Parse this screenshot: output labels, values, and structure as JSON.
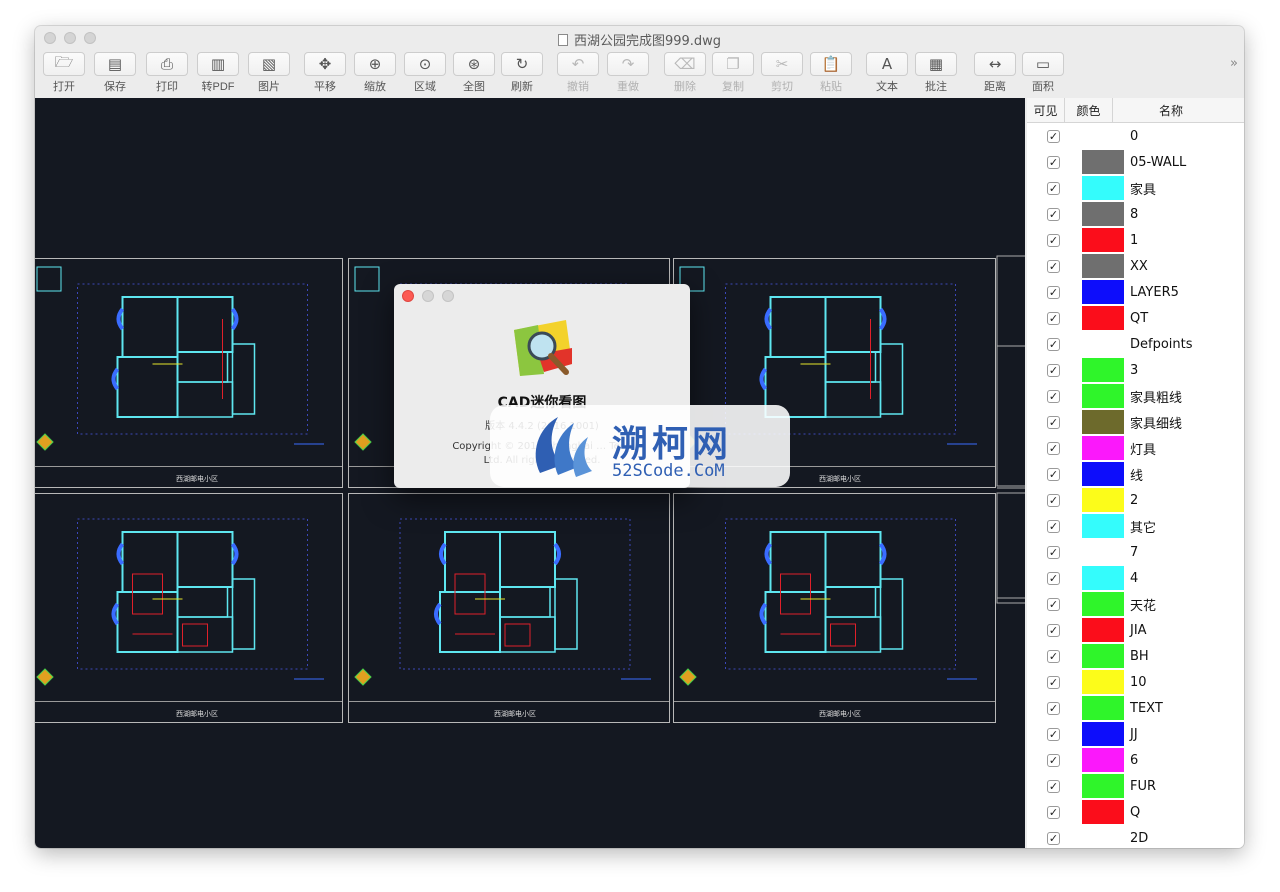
{
  "window": {
    "title": "西湖公园完成图999.dwg"
  },
  "toolbar": {
    "items": [
      {
        "label": "打开",
        "icon": "open-folder-icon",
        "glyph": "🗁",
        "disabled": false
      },
      {
        "label": "保存",
        "icon": "save-disk-icon",
        "glyph": "▤",
        "disabled": false
      },
      {
        "label": "打印",
        "icon": "printer-icon",
        "glyph": "⎙",
        "disabled": false
      },
      {
        "label": "转PDF",
        "icon": "pdf-export-icon",
        "glyph": "▥",
        "disabled": false
      },
      {
        "label": "图片",
        "icon": "image-export-icon",
        "glyph": "▧",
        "disabled": false
      },
      {
        "label": "平移",
        "icon": "pan-arrows-icon",
        "glyph": "✥",
        "disabled": false
      },
      {
        "label": "缩放",
        "icon": "zoom-icon",
        "glyph": "⊕",
        "disabled": false
      },
      {
        "label": "区域",
        "icon": "zoom-region-icon",
        "glyph": "⊙",
        "disabled": false
      },
      {
        "label": "全图",
        "icon": "zoom-extents-icon",
        "glyph": "⊛",
        "disabled": false
      },
      {
        "label": "刷新",
        "icon": "refresh-icon",
        "glyph": "↻",
        "disabled": false
      },
      {
        "label": "撤销",
        "icon": "undo-icon",
        "glyph": "↶",
        "disabled": true
      },
      {
        "label": "重做",
        "icon": "redo-icon",
        "glyph": "↷",
        "disabled": true
      },
      {
        "label": "删除",
        "icon": "eraser-icon",
        "glyph": "⌫",
        "disabled": true
      },
      {
        "label": "复制",
        "icon": "copy-icon",
        "glyph": "❐",
        "disabled": true
      },
      {
        "label": "剪切",
        "icon": "scissors-icon",
        "glyph": "✂",
        "disabled": true
      },
      {
        "label": "粘贴",
        "icon": "paste-clipboard-icon",
        "glyph": "📋",
        "disabled": true
      },
      {
        "label": "文本",
        "icon": "text-icon",
        "glyph": "A",
        "disabled": false
      },
      {
        "label": "批注",
        "icon": "note-icon",
        "glyph": "▦",
        "disabled": false
      },
      {
        "label": "距离",
        "icon": "distance-measure-icon",
        "glyph": "↔",
        "disabled": false
      },
      {
        "label": "面积",
        "icon": "area-measure-icon",
        "glyph": "▭",
        "disabled": false
      }
    ],
    "overflow": "»"
  },
  "layers": {
    "headers": {
      "visible": "可见",
      "color": "颜色",
      "name": "名称"
    },
    "rows": [
      {
        "name": "0",
        "color": "#ffffff"
      },
      {
        "name": "05-WALL",
        "color": "#6f6f6f"
      },
      {
        "name": "家具",
        "color": "#34fcfc"
      },
      {
        "name": "8",
        "color": "#6f6f6f"
      },
      {
        "name": "1",
        "color": "#fb0d1b"
      },
      {
        "name": "XX",
        "color": "#6f6f6f"
      },
      {
        "name": "LAYER5",
        "color": "#0d0dfb"
      },
      {
        "name": "QT",
        "color": "#fb0d1b"
      },
      {
        "name": "Defpoints",
        "color": "#ffffff"
      },
      {
        "name": "3",
        "color": "#2ff52a"
      },
      {
        "name": "家具粗线",
        "color": "#2ff52a"
      },
      {
        "name": "家具细线",
        "color": "#6d6a2c"
      },
      {
        "name": "灯具",
        "color": "#fb18fb"
      },
      {
        "name": "线",
        "color": "#0d0dfb"
      },
      {
        "name": "2",
        "color": "#fcfc1a"
      },
      {
        "name": "其它",
        "color": "#34fcfc"
      },
      {
        "name": "7",
        "color": "#ffffff"
      },
      {
        "name": "4",
        "color": "#34fcfc"
      },
      {
        "name": "天花",
        "color": "#2ff52a"
      },
      {
        "name": "JIA",
        "color": "#fb0d1b"
      },
      {
        "name": "BH",
        "color": "#2ff52a"
      },
      {
        "name": "10",
        "color": "#fcfc1a"
      },
      {
        "name": "TEXT",
        "color": "#2ff52a"
      },
      {
        "name": "JJ",
        "color": "#0d0dfb"
      },
      {
        "name": "6",
        "color": "#fb18fb"
      },
      {
        "name": "FUR",
        "color": "#2ff52a"
      },
      {
        "name": "Q",
        "color": "#fb0d1b"
      },
      {
        "name": "2D",
        "color": "#ffffff"
      }
    ]
  },
  "drawing": {
    "sheet_title": "西湖邮电小区"
  },
  "about": {
    "app_name": "CAD迷你看图",
    "version": "版本 4.4.2 (2016.1001)",
    "copyright_1": "Copyright © 2017 Shanghai … Tech",
    "copyright_2": "Ltd. All rights reserved."
  },
  "watermark": {
    "cn": "溯柯网",
    "en": "52SCode.CoM"
  }
}
